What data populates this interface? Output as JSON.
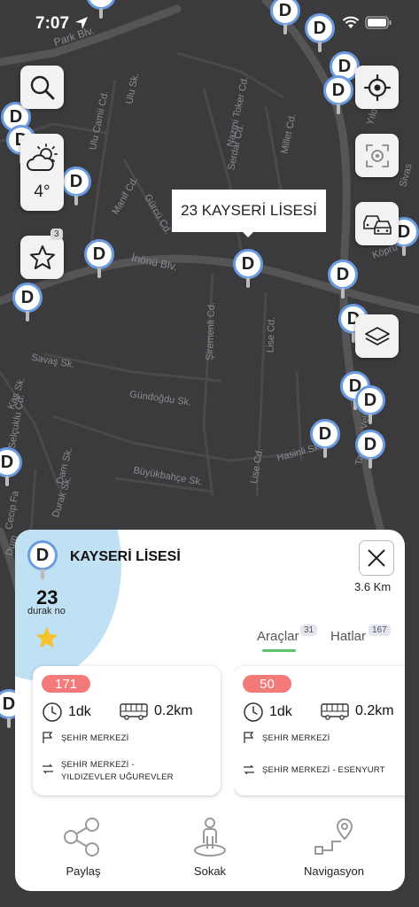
{
  "status": {
    "time": "7:07"
  },
  "map": {
    "streets": [
      "Park Blv.",
      "Ulu Sk.",
      "Ulu Camii Cd.",
      "Nazmi Toker Cd.",
      "Serdar Cd.",
      "Millet Cd.",
      "Manif Cd.",
      "Gürcü Cd.",
      "İnönü Blv.",
      "Şiremenli Cd.",
      "Lise Cd.",
      "Savaş Sk.",
      "Gündoğdu Sk.",
      "Büyükbahçe Sk.",
      "Lise Cd.",
      "Hasinli Sk.",
      "Durak Sk.",
      "Dam Sk.",
      "Selçuklu Cd.",
      "Cecip Fa",
      "Tacettin Veli",
      "Yıldız",
      "Sivas",
      "Köprü",
      "Kaş Sk.",
      "Dum"
    ],
    "stop_letter": "D",
    "tooltip": "23 KAYSERİ LİSESİ"
  },
  "controls": {
    "search_icon": "search-icon",
    "weather_icon": "partly-cloudy-icon",
    "temperature": "4°",
    "favorites_badge": "3",
    "locate_icon": "crosshair-icon",
    "focus_icon": "focus-target-icon",
    "vehicles_icon": "cars-icon",
    "layers_icon": "layers-icon"
  },
  "sheet": {
    "stop_name": "KAYSERİ LİSESİ",
    "distance": "3.6 Km",
    "stop_no": "23",
    "stop_no_label": "durak no",
    "tabs": [
      {
        "label": "Araçlar",
        "count": "31"
      },
      {
        "label": "Hatlar",
        "count": "167"
      }
    ],
    "vehicles": [
      {
        "line": "171",
        "minutes": "1dk",
        "distance": "0.2km",
        "destination": "ŞEHİR MERKEZİ",
        "route": [
          "ŞEHİR MERKEZİ -",
          "YILDIZEVLER UĞUREVLER"
        ]
      },
      {
        "line": "50",
        "minutes": "1dk",
        "distance": "0.2km",
        "destination": "ŞEHİR MERKEZİ",
        "route": [
          "ŞEHİR MERKEZİ - ESENYURT",
          ""
        ]
      }
    ],
    "actions": [
      {
        "label": "Paylaş",
        "icon": "share-icon"
      },
      {
        "label": "Sokak",
        "icon": "street-view-icon"
      },
      {
        "label": "Navigasyon",
        "icon": "navigation-route-icon"
      }
    ],
    "colors": {
      "accent_green": "#58c36a",
      "line_pill": "#f47a7a",
      "stop_ring": "#6b9be0",
      "blob": "#bfe1f3"
    }
  }
}
